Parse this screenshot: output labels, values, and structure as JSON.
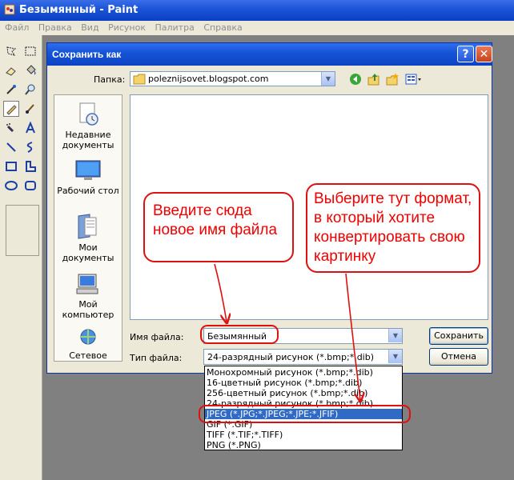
{
  "window": {
    "title": "Безымянный - Paint"
  },
  "menu": [
    "Файл",
    "Правка",
    "Вид",
    "Рисунок",
    "Палитра",
    "Справка"
  ],
  "toolbox": {
    "tools": [
      "free-select",
      "rect-select",
      "eraser",
      "fill",
      "color-picker",
      "magnifier",
      "pencil",
      "brush",
      "airbrush",
      "text",
      "line",
      "curve",
      "rectangle",
      "polygon",
      "ellipse",
      "rounded-rectangle"
    ],
    "selected": "pencil"
  },
  "dialog": {
    "title": "Сохранить как",
    "lookin_label": "Папка:",
    "lookin_value": "poleznijsovet.blogspot.com",
    "places": [
      {
        "label": "Недавние документы",
        "icon": "recent-documents-icon"
      },
      {
        "label": "Рабочий стол",
        "icon": "desktop-icon"
      },
      {
        "label": "Мои документы",
        "icon": "my-documents-icon"
      },
      {
        "label": "Мой компьютер",
        "icon": "my-computer-icon"
      },
      {
        "label": "Сетевое",
        "icon": "network-icon"
      }
    ],
    "filename_label": "Имя файла:",
    "filename_value": "Безымянный",
    "filetype_label": "Тип файла:",
    "filetype_value": "24-разрядный рисунок (*.bmp;*.dib)",
    "save_button": "Сохранить",
    "cancel_button": "Отмена"
  },
  "filetype_options": [
    "Монохромный рисунок (*.bmp;*.dib)",
    "16-цветный рисунок (*.bmp;*.dib)",
    "256-цветный рисунок (*.bmp;*.dib)",
    "24-разрядный рисунок (*.bmp;*.dib)",
    "JPEG (*.JPG;*.JPEG;*.JPE;*.JFIF)",
    "GIF (*.GIF)",
    "TIFF (*.TIF;*.TIFF)",
    "PNG (*.PNG)"
  ],
  "filetype_selected_index": 4,
  "annotations": {
    "callout_filename": "Введите сюда новое имя файла",
    "callout_format": "Выберите тут формат, в который хотите конвертировать свою картинку",
    "color": "#dd1111"
  }
}
